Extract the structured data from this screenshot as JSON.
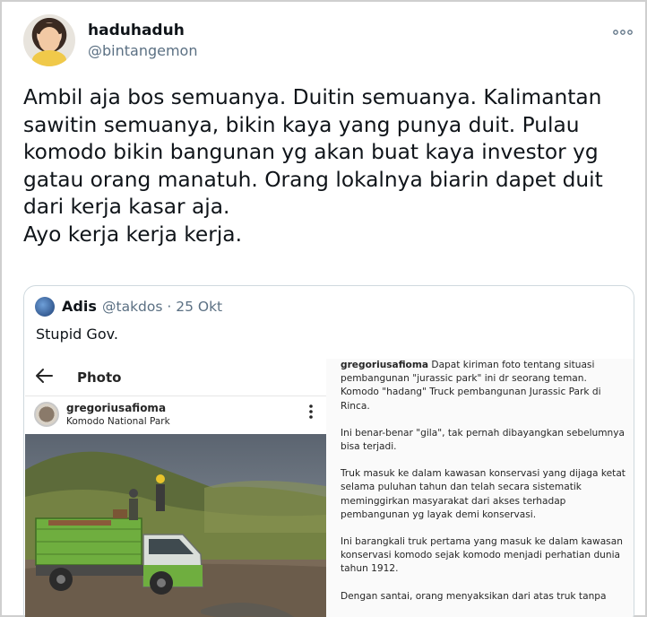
{
  "tweet": {
    "display_name": "haduhaduh",
    "handle": "@bintangemon",
    "more_icon": "more-horizontal-icon",
    "text": "Ambil aja bos semuanya. Duitin semuanya. Kalimantan\nsawitin semuanya, bikin kaya yang punya duit. Pulau\nkomodo bikin bangunan yg akan buat kaya investor yg\ngatau orang manatuh. Orang lokalnya biarin dapet duit\ndari kerja kasar aja.\nAyo kerja kerja kerja."
  },
  "quote": {
    "display_name": "Adis",
    "meta": "@takdos · 25 Okt",
    "text": "Stupid Gov.",
    "instagram": {
      "header_title": "Photo",
      "back_icon": "arrow-left-icon",
      "username": "gregoriusafioma",
      "location": "Komodo National Park",
      "options_icon": "more-vertical-icon",
      "caption_user": "gregoriusafioma",
      "caption_paragraphs": [
        "Dapat kiriman foto  tentang situasi pembangunan \"jurassic park\" ini dr seorang teman. Komodo \"hadang\" Truck pembangunan Jurassic Park di Rinca.",
        "Ini benar-benar \"gila\", tak pernah dibayangkan sebelumnya bisa terjadi.",
        "Truk masuk ke dalam kawasan konservasi yang dijaga ketat selama puluhan tahun dan telah secara sistematik meminggirkan masyarakat dari akses terhadap pembangunan yg layak demi konservasi.",
        "Ini barangkali truk pertama yang masuk ke dalam kawasan konservasi komodo sejak komodo menjadi perhatian dunia tahun 1912.",
        "Dengan santai, orang menyaksikan dari atas truk tanpa"
      ]
    }
  },
  "colors": {
    "text": "#0f1419",
    "secondary": "#5b7083",
    "border": "#cfd9de",
    "truck_green": "#6fae3f"
  }
}
